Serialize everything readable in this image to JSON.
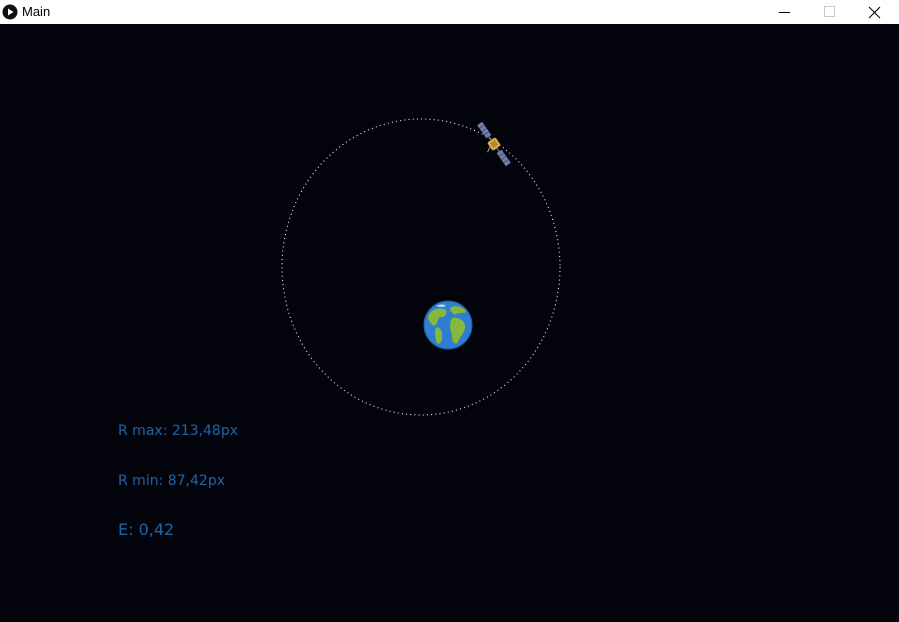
{
  "window": {
    "title": "Main",
    "app_icon": "play-icon",
    "controls": {
      "minimize_icon": "minimize-icon",
      "maximize_icon": "maximize-icon",
      "close_icon": "close-icon"
    }
  },
  "scene": {
    "background_color": "#03040b",
    "orbit_color": "#ffffff",
    "planet_icon": "earth-icon",
    "satellite_icon": "satellite-icon"
  },
  "readouts": {
    "r_max": "R max: 213,48px",
    "r_min": "R min: 87,42px",
    "eccentricity": "E: 0,42",
    "text_color": "#1f64a8"
  }
}
